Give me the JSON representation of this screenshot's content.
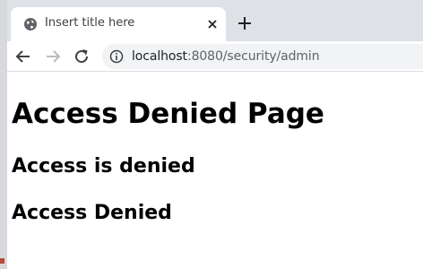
{
  "browser": {
    "tab": {
      "title": "Insert title here",
      "favicon": "globe-icon"
    },
    "new_tab_label": "+",
    "address_bar": {
      "host": "localhost",
      "path": ":8080/security/admin",
      "info_icon": "info-icon"
    },
    "nav": {
      "back": "back-arrow-icon",
      "forward": "forward-arrow-icon",
      "reload": "reload-icon"
    }
  },
  "page": {
    "heading": "Access Denied Page",
    "message1": "Access is denied",
    "message2": "Access Denied"
  },
  "colors": {
    "tabbar_bg": "#dee1e6",
    "omnibox_bg": "#f1f3f4",
    "text": "#000000"
  }
}
